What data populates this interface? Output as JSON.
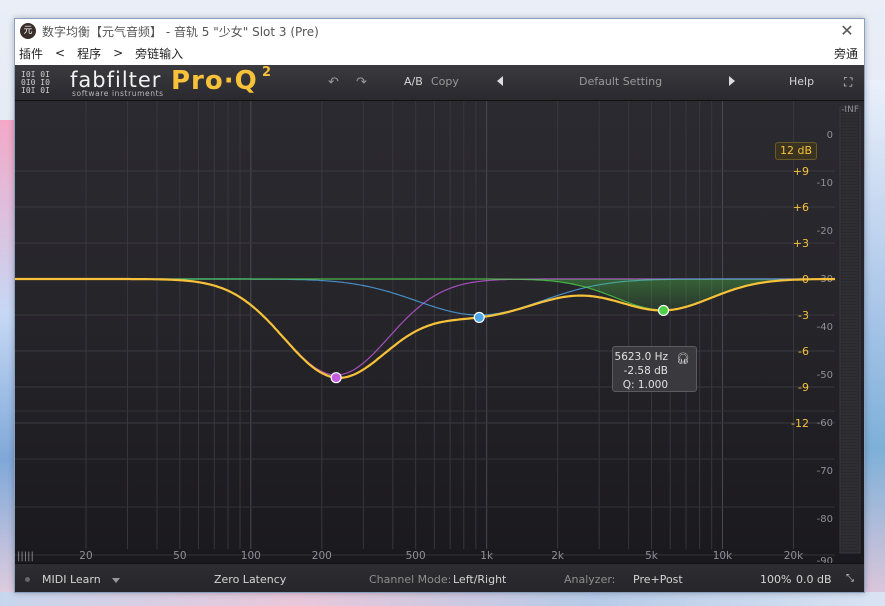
{
  "window": {
    "icon_char": "元",
    "title": "数字均衡【元气音频】 - 音轨 5 \"少女\" Slot 3 (Pre)",
    "menu": [
      "插件",
      "<",
      "程序",
      ">",
      "旁链输入"
    ],
    "menu_right": "旁通"
  },
  "plugin": {
    "brand": "fabfilter",
    "brand_sub": "software instruments",
    "product": "Pro·Q",
    "product_sup": "2",
    "header": {
      "undo_icon": "undo-icon",
      "redo_icon": "redo-icon",
      "ab_label": "A/B",
      "copy_label": "Copy",
      "preset_name": "Default Setting",
      "help_label": "Help",
      "fullscreen_icon": "fullscreen-icon"
    },
    "range_badge": "12 dB",
    "freq_labels": [
      "20",
      "50",
      "100",
      "200",
      "500",
      "1k",
      "2k",
      "5k",
      "10k",
      "20k"
    ],
    "gain_labels": [
      "+9",
      "+6",
      "+3",
      "0",
      "-3",
      "-6",
      "-9",
      "-12"
    ],
    "analyzer_labels": [
      "-INF",
      "0",
      "-10",
      "-20",
      "-30",
      "-40",
      "-50",
      "-60",
      "-70",
      "-80",
      "-90"
    ],
    "tooltip": {
      "freq": "5623.0 Hz",
      "gain": "-2.58 dB",
      "q": "Q: 1.000",
      "icon": "headphones-icon"
    },
    "bands": [
      {
        "name": "band-1",
        "color": "#c45be0",
        "freq_hz": 230,
        "gain_db": -8.0
      },
      {
        "name": "band-2",
        "color": "#4fa6e8",
        "freq_hz": 930,
        "gain_db": -3.0
      },
      {
        "name": "band-3",
        "color": "#4fd04a",
        "freq_hz": 5623,
        "gain_db": -2.58
      }
    ],
    "bottom": {
      "midi_learn": "MIDI Learn",
      "latency": "Zero Latency",
      "channel_mode_label": "Channel Mode:",
      "channel_mode_value": "Left/Right",
      "analyzer_label": "Analyzer:",
      "analyzer_value": "Pre+Post",
      "zoom": "100%",
      "output_gain": "0.0 dB"
    },
    "colors": {
      "curve": "#f7c23a",
      "accent": "#f7c23a",
      "band1": "#c45be0",
      "band2": "#4fa6e8",
      "band3": "#4fd04a"
    }
  }
}
